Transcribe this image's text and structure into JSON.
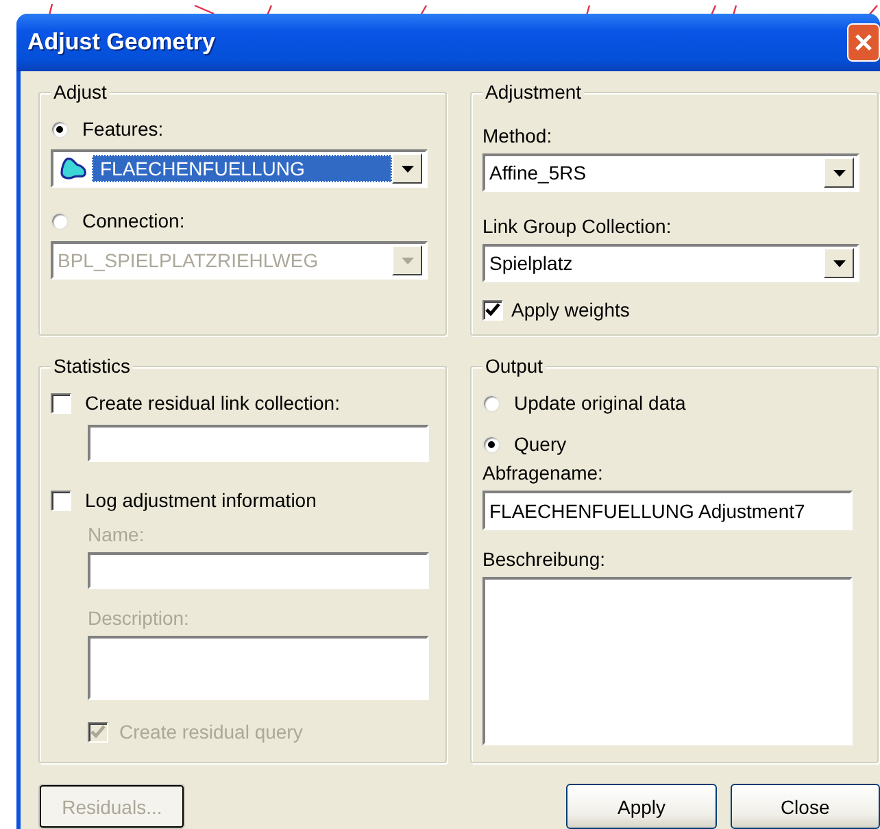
{
  "window": {
    "title": "Adjust Geometry"
  },
  "adjust": {
    "title": "Adjust",
    "options": [
      {
        "label": "Features:",
        "selected": true,
        "dropdown": {
          "value": "FLAECHENFUELLUNG",
          "disabled": false,
          "highlighted": true
        }
      },
      {
        "label": "Connection:",
        "selected": false,
        "dropdown": {
          "value": "BPL_SPIELPLATZRIEHLWEG",
          "disabled": true,
          "highlighted": false
        }
      }
    ]
  },
  "adjustment": {
    "title": "Adjustment",
    "method": {
      "label": "Method:",
      "value": "Affine_5RS"
    },
    "link_group_collection": {
      "label": "Link Group Collection:",
      "value": "Spielplatz"
    },
    "apply_weights": {
      "label": "Apply weights",
      "checked": true,
      "disabled": false
    }
  },
  "statistics": {
    "title": "Statistics",
    "create_residual_link_collection": {
      "label": "Create residual link collection:",
      "checked": false,
      "disabled": false
    },
    "log_adjustment_information": {
      "label": "Log adjustment information",
      "checked": false,
      "disabled": false
    },
    "name": {
      "label": "Name:",
      "disabled": true
    },
    "description": {
      "label": "Description:",
      "disabled": true
    },
    "create_residual_query": {
      "label": "Create residual query",
      "checked": true,
      "disabled": true
    }
  },
  "output": {
    "title": "Output",
    "options": [
      {
        "label": "Update original data",
        "selected": false
      },
      {
        "label": "Query",
        "selected": true
      }
    ],
    "abfragename": {
      "label": "Abfragename:",
      "value": "FLAECHENFUELLUNG Adjustment7"
    },
    "beschreibung": {
      "label": "Beschreibung:"
    }
  },
  "buttons": [
    {
      "label": "Residuals...",
      "disabled": true
    },
    {
      "label": "Apply",
      "disabled": false
    },
    {
      "label": "Close",
      "disabled": false
    }
  ]
}
